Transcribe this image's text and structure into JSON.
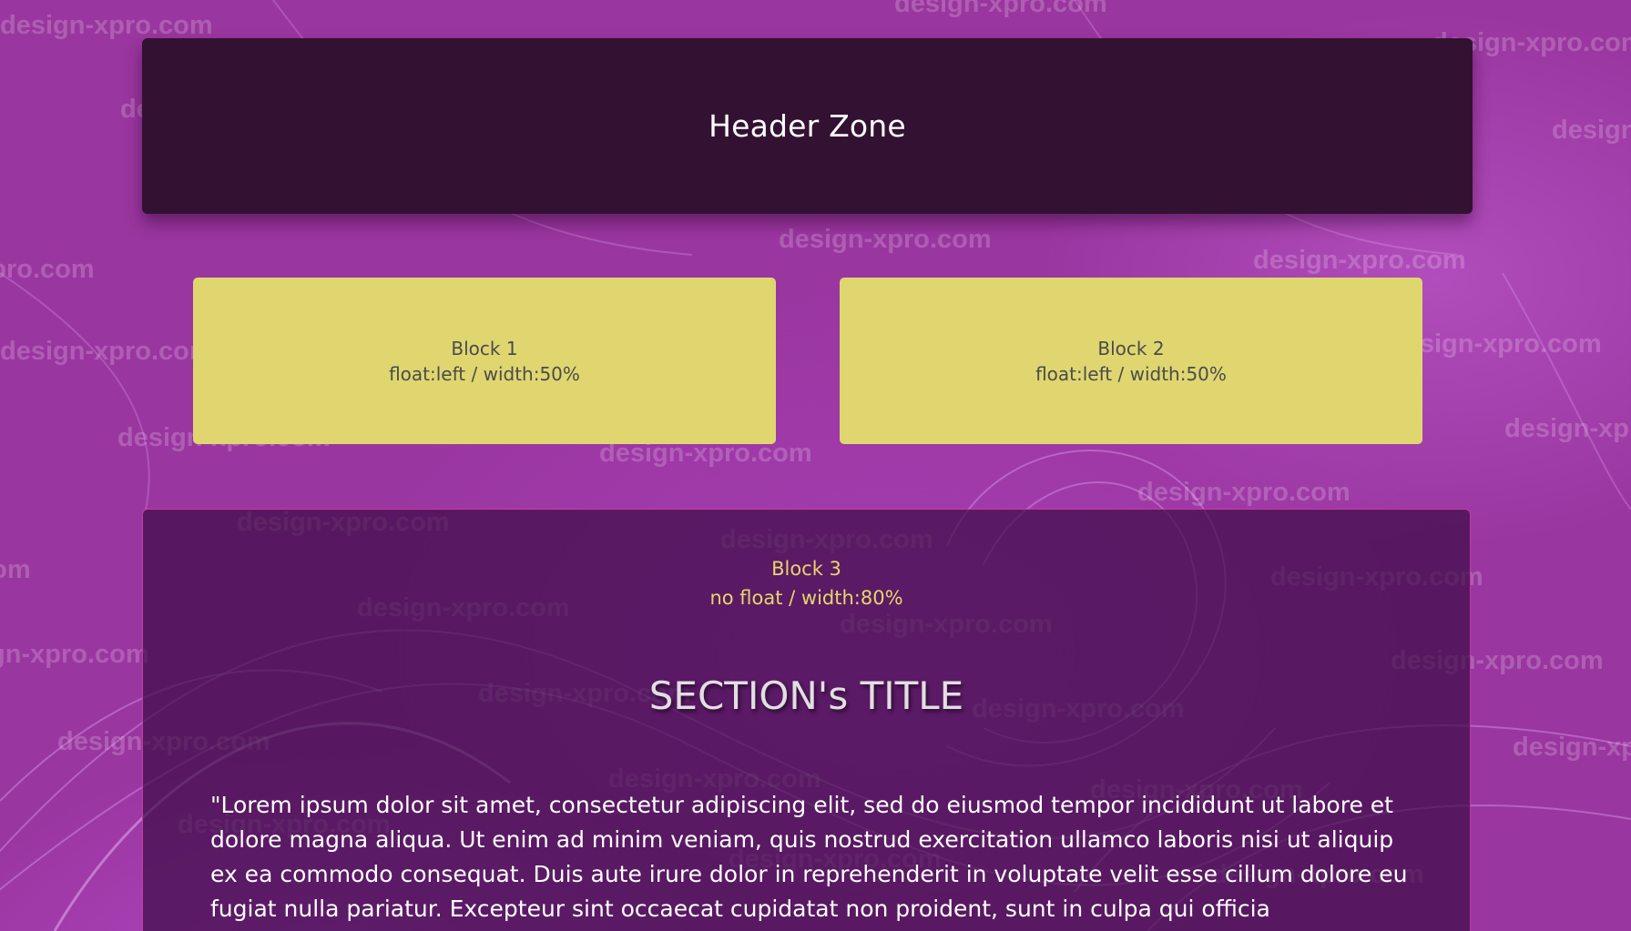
{
  "header": {
    "title": "Header Zone"
  },
  "blocks": [
    {
      "title": "Block 1",
      "subtitle": "float:left / width:50%"
    },
    {
      "title": "Block 2",
      "subtitle": "float:left / width:50%"
    }
  ],
  "block3": {
    "title": "Block 3",
    "subtitle": "no float / width:80%",
    "section_title": "SECTION's TITLE",
    "paragraph": "\"Lorem ipsum dolor sit amet, consectetur adipiscing elit, sed do eiusmod tempor incididunt ut labore et dolore magna aliqua. Ut enim ad minim veniam, quis nostrud exercitation ullamco laboris nisi ut aliquip ex ea commodo consequat. Duis aute irure dolor in reprehenderit in voluptate velit esse cillum dolore eu fugiat nulla pariatur. Excepteur sint occaecat cupidatat non proident, sunt in culpa qui officia"
  },
  "watermark": {
    "text": "design-xpro.com"
  },
  "colors": {
    "background": "#9a36a0",
    "header_bg": "#331132",
    "block_yellow": "#dfd670",
    "block3_label": "#e8d46a",
    "block3_border": "#c63c9c"
  }
}
